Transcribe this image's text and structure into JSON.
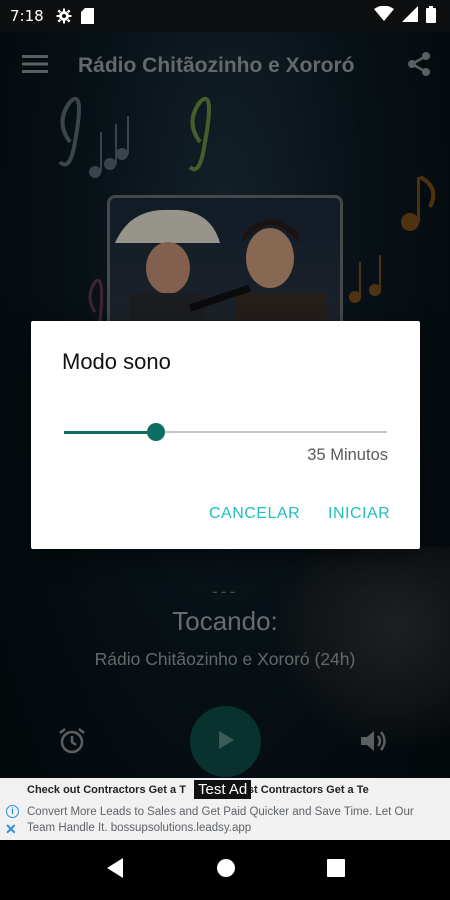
{
  "status_bar": {
    "time": "7:18"
  },
  "toolbar": {
    "title": "Rádio Chitãozinho e Xororó"
  },
  "player": {
    "dashes": "---",
    "now_playing_label": "Tocando:",
    "station_name": "Rádio Chitãozinho e Xororó (24h)"
  },
  "dialog": {
    "title": "Modo sono",
    "slider_value_label": "35 Minutos",
    "slider_fraction": 0.285,
    "cancel_label": "CANCELAR",
    "start_label": "INICIAR"
  },
  "ad": {
    "headline": "Check out Contractors Get a T",
    "headline_right": "st Contractors Get a Te",
    "test_label": "Test Ad",
    "body": "Convert More Leads to Sales and Get Paid Quicker and Save Time. Let Our Team Handle It. bossupsolutions.leadsy.app"
  },
  "colors": {
    "accent": "#1fc0bc",
    "slider": "#0c6e62",
    "play_button": "#0e4e48"
  },
  "icons": {
    "menu": "menu-icon",
    "share": "share-icon",
    "alarm": "alarm-icon",
    "play": "play-icon",
    "volume": "volume-icon",
    "settings": "gear-icon",
    "sd_card": "sd-card-icon",
    "wifi": "wifi-icon",
    "signal": "signal-icon",
    "battery": "battery-icon"
  }
}
